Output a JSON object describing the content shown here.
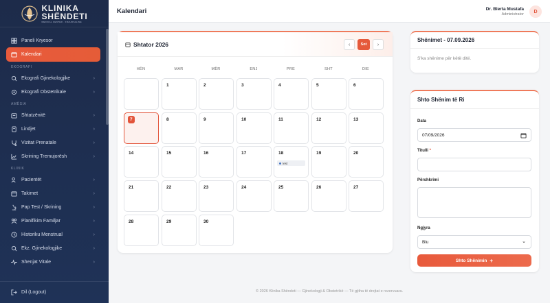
{
  "app": {
    "logo_line1": "KLINIKA",
    "logo_line2": "SHËNDETI",
    "logo_tagline": "MEDICAL CENTER · FRAUDSALINE"
  },
  "sidebar": {
    "items": [
      {
        "label": "Paneli Kryesor",
        "icon": "dashboard-icon"
      },
      {
        "label": "Kalendari",
        "icon": "calendar-icon",
        "active": true
      }
    ],
    "sections": [
      {
        "title": "EKOGRAFI",
        "items": [
          {
            "label": "Ekografi Gjinekologjike",
            "icon": "ultrasound-icon"
          },
          {
            "label": "Ekografi Obstetrikale",
            "icon": "ultrasound-icon"
          }
        ]
      },
      {
        "title": "AMËSIA",
        "items": [
          {
            "label": "Shtatzënitë",
            "icon": "pregnancy-icon"
          },
          {
            "label": "Lindjet",
            "icon": "birth-icon"
          },
          {
            "label": "Vizitat Prenatale",
            "icon": "stethoscope-icon"
          },
          {
            "label": "Skrining Tremujorësh",
            "icon": "chart-icon"
          }
        ]
      },
      {
        "title": "KLINIK",
        "items": [
          {
            "label": "Pacientët",
            "icon": "users-icon"
          },
          {
            "label": "Takimet",
            "icon": "calendar-icon"
          },
          {
            "label": "Pap Test / Skrining",
            "icon": "microscope-icon"
          },
          {
            "label": "Planifikim Familjar",
            "icon": "family-icon"
          },
          {
            "label": "Historiku Menstrual",
            "icon": "history-icon"
          },
          {
            "label": "Ekz. Gjinekologjike",
            "icon": "search-icon"
          },
          {
            "label": "Shenjat Vitale",
            "icon": "heartbeat-icon"
          }
        ]
      }
    ],
    "logout_label": "Dil (Logout)"
  },
  "header": {
    "title": "Kalendari",
    "user_name": "Dr. Blerta Mustafa",
    "user_role": "Administrator",
    "avatar_initial": "D"
  },
  "calendar": {
    "month_label": "Shtator 2026",
    "today_button": "Sot",
    "prev_icon": "‹",
    "next_icon": "›",
    "weekdays": [
      "HËN",
      "MAR",
      "MËR",
      "ENJ",
      "PRE",
      "SHT",
      "DIE"
    ],
    "start_offset": 1,
    "days_in_month": 30,
    "today": 7,
    "events": [
      {
        "day": 18,
        "label": "test",
        "color": "#4a78c4"
      }
    ]
  },
  "notes_card": {
    "title": "Shënimet - 07.09.2026",
    "empty_text": "S'ka shënime për këtë ditë."
  },
  "add_note": {
    "title": "Shto Shënim të Ri",
    "date_label": "Data",
    "date_value": "07/09/2026",
    "title_label": "Titulli",
    "required_mark": "*",
    "title_value": "",
    "desc_label": "Përshkrimi",
    "desc_value": "",
    "color_label": "Ngjyra",
    "color_value": "Blu",
    "submit_label": "Shto Shënimin",
    "submit_icon": "+"
  },
  "footer": {
    "text": "© 2026 Klinika Shëndeti — Gjinekologji & Obstetrikë — Të gjitha të drejtat e rezervuara."
  },
  "colors": {
    "accent": "#e55a3b",
    "sidebar": "#1d2b4a"
  }
}
